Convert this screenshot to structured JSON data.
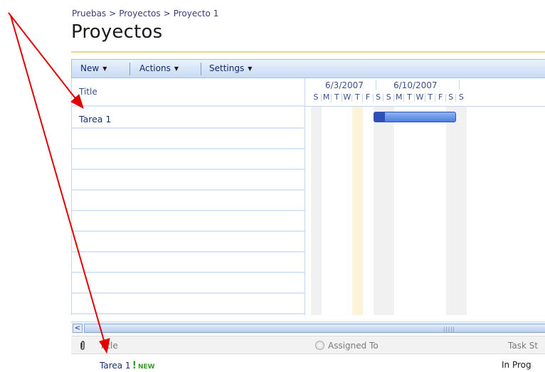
{
  "breadcrumb": {
    "items": [
      "Pruebas",
      "Proyectos",
      "Proyecto 1"
    ],
    "separator": ">"
  },
  "page_title": "Proyectos",
  "toolbar": {
    "new_label": "New",
    "actions_label": "Actions",
    "settings_label": "Settings"
  },
  "grid": {
    "title_header": "Title",
    "rows": [
      "Tarea 1",
      "",
      "",
      "",
      "",
      "",
      "",
      "",
      "",
      ""
    ]
  },
  "gantt": {
    "weeks": [
      "6/3/2007",
      "6/10/2007"
    ],
    "days": [
      "S",
      "M",
      "T",
      "W",
      "T",
      "F",
      "S",
      "S",
      "M",
      "T",
      "W",
      "T",
      "F",
      "S",
      "S"
    ],
    "tasks": [
      {
        "name": "Tarea 1",
        "start_day_index": 6,
        "end_day_index": 14,
        "percent_complete": 13
      }
    ]
  },
  "scrollbar": {
    "left_arrow": "<",
    "grip": "|||||"
  },
  "list_header": {
    "title": "Title",
    "assigned_to": "Assigned To",
    "task_status": "Task St"
  },
  "list_rows": [
    {
      "title": "Tarea 1",
      "flag": "!",
      "new_badge": "NEW",
      "status": "In Prog"
    }
  ],
  "annotation_color": "#e00000",
  "icons": [
    "paperclip-icon",
    "presence-icon",
    "dropdown-caret-icon",
    "scroll-left-icon",
    "annotation-arrow"
  ]
}
